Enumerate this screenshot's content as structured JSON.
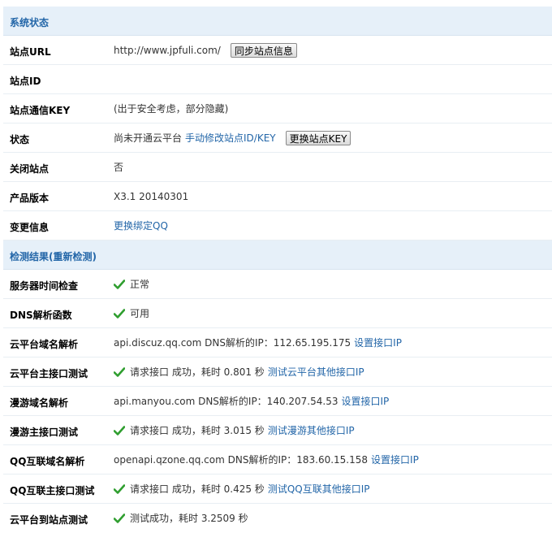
{
  "system_status": {
    "title": "系统状态",
    "site_url": {
      "label": "站点URL",
      "value": "http://www.jpfuli.com/",
      "button": "同步站点信息"
    },
    "site_id": {
      "label": "站点ID",
      "value": ""
    },
    "site_key": {
      "label": "站点通信KEY",
      "value": "(出于安全考虑，部分隐藏)"
    },
    "status": {
      "label": "状态",
      "value": "尚未开通云平台",
      "link": "手动修改站点ID/KEY",
      "button": "更换站点KEY"
    },
    "close_site": {
      "label": "关闭站点",
      "value": "否"
    },
    "version": {
      "label": "产品版本",
      "value": "X3.1 20140301"
    },
    "change_info": {
      "label": "变更信息",
      "link": "更换绑定QQ"
    }
  },
  "check_results": {
    "title": "检测结果(重新检测)",
    "server_time": {
      "label": "服务器时间检查",
      "value": "正常"
    },
    "dns_func": {
      "label": "DNS解析函数",
      "value": "可用"
    },
    "cloud_dns": {
      "label": "云平台域名解析",
      "value": "api.discuz.qq.com DNS解析的IP：112.65.195.175",
      "link": "设置接口IP"
    },
    "cloud_api": {
      "label": "云平台主接口测试",
      "value": "请求接口 成功，耗时 0.801 秒",
      "link": "测试云平台其他接口IP"
    },
    "manyou_dns": {
      "label": "漫游域名解析",
      "value": "api.manyou.com DNS解析的IP：140.207.54.53",
      "link": "设置接口IP"
    },
    "manyou_api": {
      "label": "漫游主接口测试",
      "value": "请求接口 成功，耗时 3.015 秒",
      "link": "测试漫游其他接口IP"
    },
    "qq_dns": {
      "label": "QQ互联域名解析",
      "value": "openapi.qzone.qq.com DNS解析的IP：183.60.15.158",
      "link": "设置接口IP"
    },
    "qq_api": {
      "label": "QQ互联主接口测试",
      "value": "请求接口 成功，耗时 0.425 秒",
      "link": "测试QQ互联其他接口IP"
    },
    "cloud_to_site": {
      "label": "云平台到站点测试",
      "value": "测试成功，耗时 3.2509 秒"
    }
  },
  "icons": {
    "success": "checkmark-icon"
  },
  "colors": {
    "accent": "#2366a8",
    "header_bg": "#e6f0f9",
    "success": "#2f9e2f"
  }
}
